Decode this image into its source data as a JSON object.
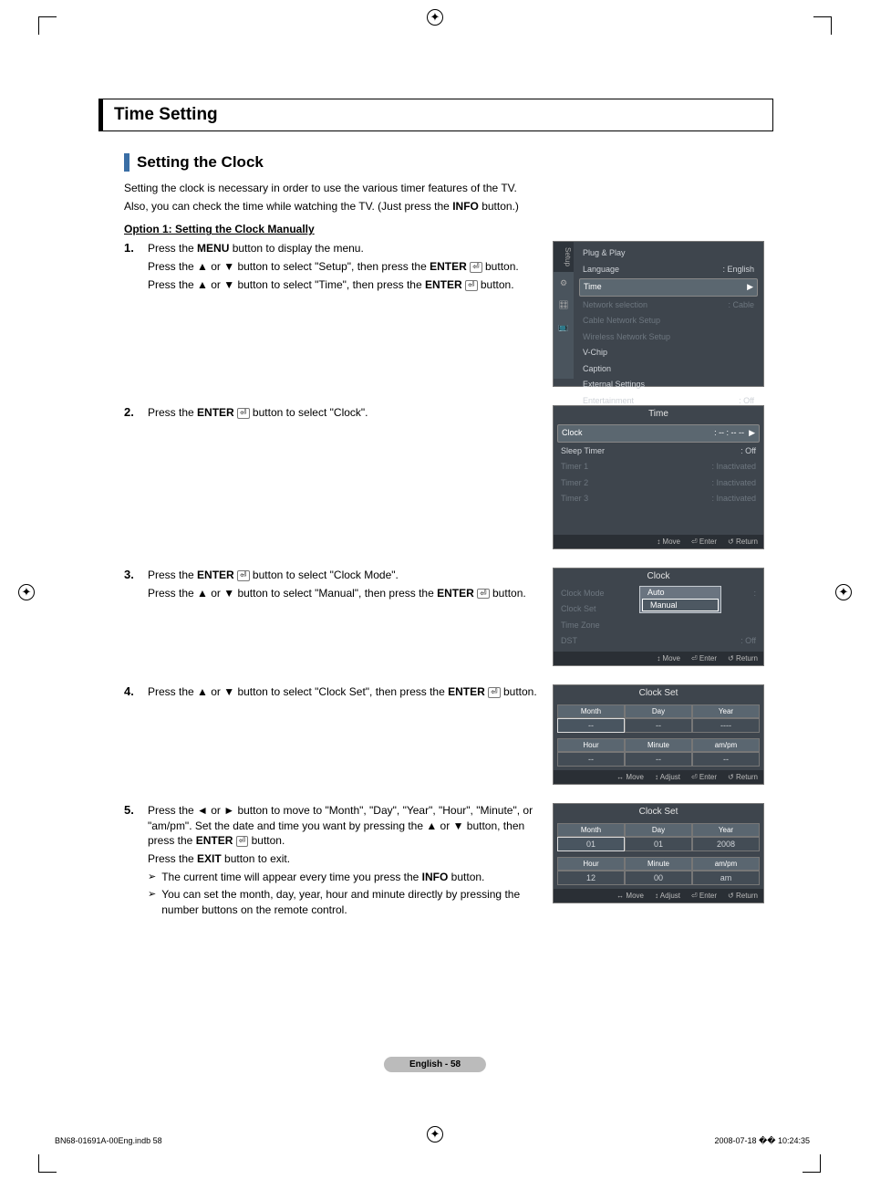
{
  "page": {
    "title_bar": "Time Setting",
    "section_heading": "Setting the Clock",
    "intro_line1": "Setting the clock is necessary in order to use the various timer features of the TV.",
    "intro_line2_a": "Also, you can check the time while watching the TV. (Just press the ",
    "intro_line2_b": "INFO",
    "intro_line2_c": " button.)",
    "option_heading": "Option 1: Setting the Clock Manually",
    "steps": {
      "s1": {
        "n": "1.",
        "l1a": "Press the ",
        "l1b": "MENU",
        "l1c": " button to display the menu.",
        "l2a": "Press the ▲ or ▼ button to select \"Setup\", then press the ",
        "l2b": "ENTER",
        "l2c": " button.",
        "l3a": "Press the ▲ or ▼ button to select \"Time\", then press the ",
        "l3b": "ENTER",
        "l3c": " button."
      },
      "s2": {
        "n": "2.",
        "l1a": "Press the ",
        "l1b": "ENTER",
        "l1c": " button to select \"Clock\"."
      },
      "s3": {
        "n": "3.",
        "l1a": "Press the ",
        "l1b": "ENTER",
        "l1c": " button to select \"Clock Mode\".",
        "l2a": "Press the ▲ or ▼ button to select \"Manual\", then press the ",
        "l2b": "ENTER",
        "l2c": " button."
      },
      "s4": {
        "n": "4.",
        "l1a": "Press the ▲ or ▼ button to select \"Clock Set\", then press the ",
        "l1b": "ENTER",
        "l1c": " button."
      },
      "s5": {
        "n": "5.",
        "l1a": "Press the ◄ or ► button to move to \"Month\", \"Day\", \"Year\", \"Hour\", \"Minute\", or \"am/pm\". Set the date and time you want by pressing the ▲ or ▼ button, then press the ",
        "l1b": "ENTER",
        "l1c": " button.",
        "l2a": "Press the ",
        "l2b": "EXIT",
        "l2c": " button to exit.",
        "tip1a": "The current time will appear every time you press the ",
        "tip1b": "INFO",
        "tip1c": " button.",
        "tip2": "You can set the month, day, year, hour and minute directly by pressing the number buttons on the remote control."
      }
    }
  },
  "osd_setup": {
    "tab": "Setup",
    "r_plug": "Plug & Play",
    "r_lang_l": "Language",
    "r_lang_v": ": English",
    "r_time": "Time",
    "r_net_l": "Network selection",
    "r_net_v": ": Cable",
    "r_cable": "Cable Network Setup",
    "r_wire": "Wireless Network Setup",
    "r_vchip": "V-Chip",
    "r_caption": "Caption",
    "r_ext": "External Settings",
    "r_ent_l": "Entertainment",
    "r_ent_v": ": Off"
  },
  "osd_time": {
    "title": "Time",
    "clock_l": "Clock",
    "clock_v": ": -- : -- --",
    "sleep_l": "Sleep Timer",
    "sleep_v": ": Off",
    "t1_l": "Timer 1",
    "t1_v": ": Inactivated",
    "t2_l": "Timer 2",
    "t2_v": ": Inactivated",
    "t3_l": "Timer 3",
    "t3_v": ": Inactivated",
    "f_move": "Move",
    "f_enter": "Enter",
    "f_return": "Return"
  },
  "osd_clock": {
    "title": "Clock",
    "mode": "Clock Mode",
    "mode_v": ":",
    "set": "Clock Set",
    "zone": "Time Zone",
    "dst_l": "DST",
    "dst_v": ": Off",
    "opt_auto": "Auto",
    "opt_manual": "Manual",
    "f_move": "Move",
    "f_enter": "Enter",
    "f_return": "Return"
  },
  "osd_set_blank": {
    "title": "Clock Set",
    "month": "Month",
    "day": "Day",
    "year": "Year",
    "hour": "Hour",
    "minute": "Minute",
    "ampm": "am/pm",
    "dash2": "--",
    "dash4": "----",
    "f_move": "Move",
    "f_adj": "Adjust",
    "f_enter": "Enter",
    "f_return": "Return"
  },
  "osd_set_vals": {
    "title": "Clock Set",
    "month": "Month",
    "day": "Day",
    "year": "Year",
    "hour": "Hour",
    "minute": "Minute",
    "ampm": "am/pm",
    "v_month": "01",
    "v_day": "01",
    "v_year": "2008",
    "v_hour": "12",
    "v_minute": "00",
    "v_ampm": "am",
    "f_move": "Move",
    "f_adj": "Adjust",
    "f_enter": "Enter",
    "f_return": "Return"
  },
  "footer": {
    "badge": "English - 58",
    "left": "BN68-01691A-00Eng.indb   58",
    "right": "2008-07-18   �� 10:24:35"
  },
  "glyph": {
    "enter": "⏎",
    "updown": "↕",
    "leftright": "↔",
    "ret": "↺",
    "tri": "▶",
    "arrow": "➢"
  }
}
